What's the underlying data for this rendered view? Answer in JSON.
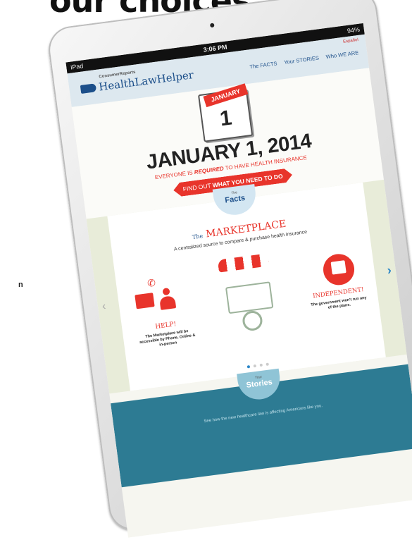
{
  "headline": "our choices",
  "side_letter": "n",
  "statusbar": {
    "device": "iPad",
    "time": "3:06 PM",
    "battery": "94%"
  },
  "header": {
    "brand_small": "ConsumerReports",
    "brand": "HealthLawHelper",
    "language_link": "Español",
    "nav": [
      "The FACTS",
      "Your STORIES",
      "Who WE ARE"
    ]
  },
  "hero": {
    "calendar_month": "JANUARY",
    "calendar_day": "1",
    "title": "JANUARY 1, 2014",
    "sub_before": "EVERYONE IS ",
    "sub_emph": "REQUIRED",
    "sub_after": " TO HAVE HEALTH INSURANCE",
    "cta_before": "FIND OUT ",
    "cta_emph": "WHAT YOU NEED TO DO"
  },
  "facts": {
    "tab_small": "The",
    "tab_big": "Facts",
    "title_the": "The",
    "title": "MARKETPLACE",
    "subtitle": "A centralized source to compare & purchase health insurance",
    "help_label": "HELP!",
    "help_text": "The Marketplace will be accessible by Phone, Online & in-person",
    "ind_label": "INDEPENDENT!",
    "ind_text": "The government won't run any of the plans."
  },
  "stories": {
    "tab_small": "Your",
    "tab_big": "Stories",
    "text": "See how the new healthcare law is affecting Americans like you."
  }
}
